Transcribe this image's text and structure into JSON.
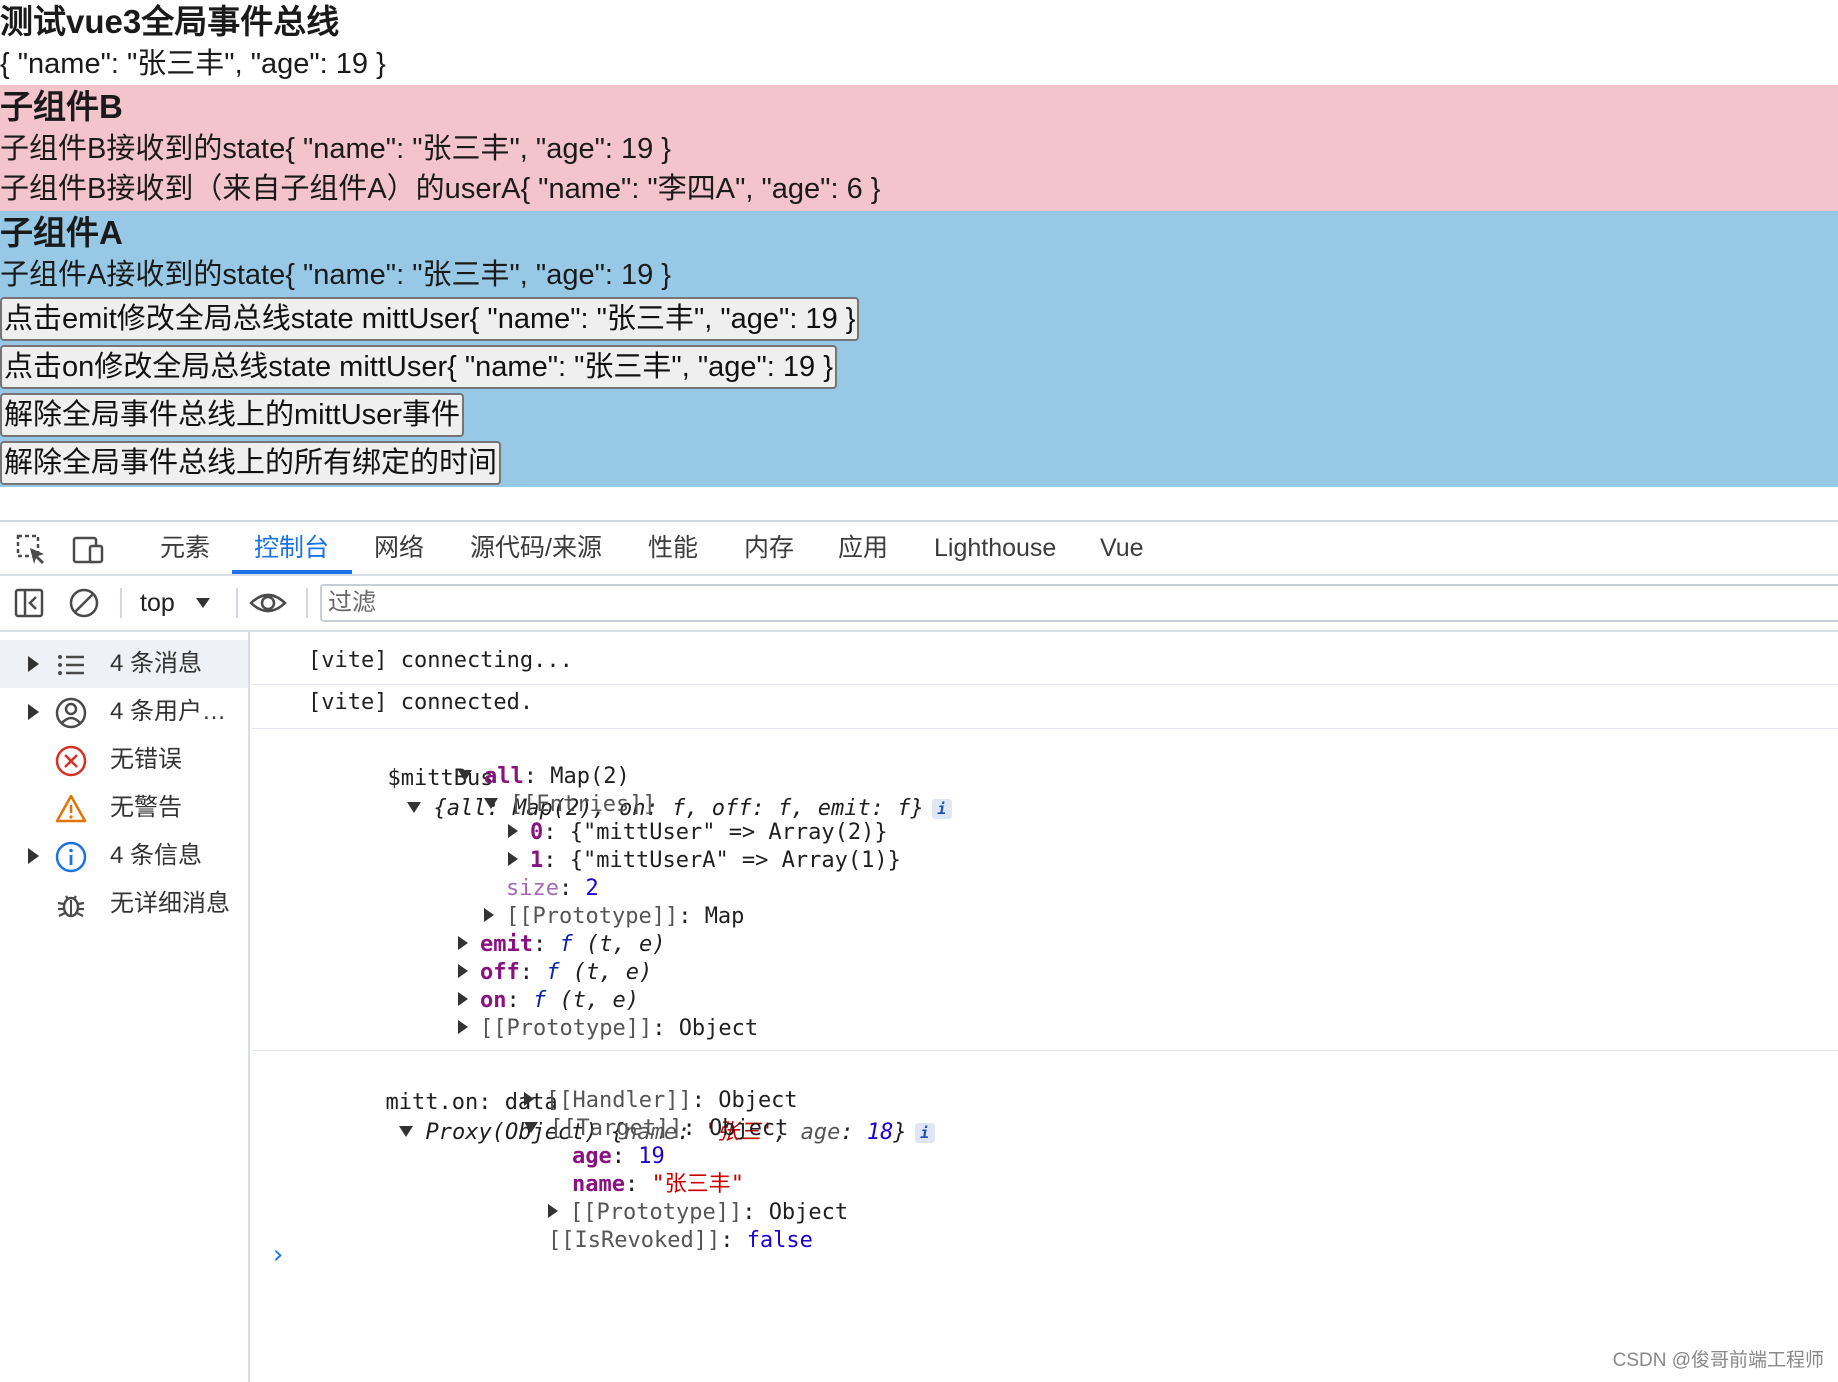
{
  "page": {
    "title": "测试vue3全局事件总线",
    "global_state": "{ \"name\": \"张三丰\", \"age\": 19 }"
  },
  "panel_b": {
    "title": "子组件B",
    "line1": "子组件B接收到的state{ \"name\": \"张三丰\", \"age\": 19 }",
    "line2": "子组件B接收到（来自子组件A）的userA{ \"name\": \"李四A\", \"age\": 6 }",
    "bg": "#f4c4cc"
  },
  "panel_a": {
    "title": "子组件A",
    "line1": "子组件A接收到的state{ \"name\": \"张三丰\", \"age\": 19 }",
    "btn_emit": "点击emit修改全局总线state mittUser{ \"name\": \"张三丰\", \"age\": 19 }",
    "btn_on": "点击on修改全局总线state mittUser{ \"name\": \"张三丰\", \"age\": 19 }",
    "btn_off": "解除全局事件总线上的mittUser事件",
    "btn_clear": "解除全局事件总线上的所有绑定的时间",
    "bg": "#97c9e6"
  },
  "devtools": {
    "tabs": [
      "元素",
      "控制台",
      "网络",
      "源代码/来源",
      "性能",
      "内存",
      "应用",
      "Lighthouse",
      "Vue"
    ],
    "active_tab": "控制台",
    "context": "top",
    "filter_placeholder": "过滤",
    "sidebar": [
      {
        "label": "4 条消息",
        "icon": "list-icon"
      },
      {
        "label": "4 条用户…",
        "icon": "user-icon"
      },
      {
        "label": "无错误",
        "icon": "error-icon"
      },
      {
        "label": "无警告",
        "icon": "warning-icon"
      },
      {
        "label": "4 条信息",
        "icon": "info-icon"
      },
      {
        "label": "无详细消息",
        "icon": "bug-icon"
      }
    ],
    "accent": "#1a73e8"
  },
  "console": {
    "vite1": "[vite] connecting...",
    "vite2": "[vite] connected.",
    "mitt": {
      "label": "$mittBus",
      "summary_all": "all",
      "summary_all_val": "Map(2)",
      "summary_on": "on",
      "summary_off": "off",
      "summary_emit": "emit",
      "f": "f",
      "all_key": "all",
      "all_val": "Map(2)",
      "entries": "[[Entries]]",
      "entry0_key": "0",
      "entry0_val": "{\"mittUser\" => Array(2)}",
      "entry1_key": "1",
      "entry1_val": "{\"mittUserA\" => Array(1)}",
      "size_key": "size",
      "size_val": "2",
      "map_proto": "[[Prototype]]",
      "map_proto_val": "Map",
      "emit_key": "emit",
      "off_key": "off",
      "on_key": "on",
      "args": "(t, e)",
      "obj_proto": "[[Prototype]]",
      "obj_proto_val": "Object"
    },
    "data": {
      "label": "mitt.on: data",
      "proxy": "Proxy(Object)",
      "name_key": "name",
      "name_val": "'张三'",
      "age_key": "age",
      "age_val": "18",
      "handler": "[[Handler]]",
      "handler_val": "Object",
      "target": "[[Target]]",
      "target_val": "Object",
      "t_age_key": "age",
      "t_age_val": "19",
      "t_name_key": "name",
      "t_name_val": "\"张三丰\"",
      "t_proto": "[[Prototype]]",
      "t_proto_val": "Object",
      "revoked": "[[IsRevoked]]",
      "revoked_val": "false"
    }
  },
  "watermark": "CSDN @俊哥前端工程师"
}
